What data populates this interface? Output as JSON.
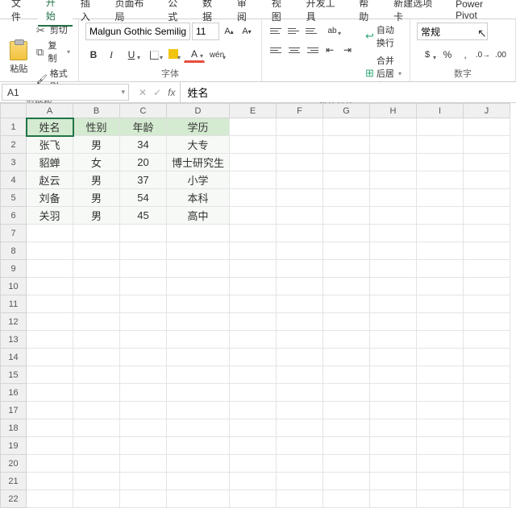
{
  "menus": [
    "文件",
    "开始",
    "插入",
    "页面布局",
    "公式",
    "数据",
    "审阅",
    "视图",
    "开发工具",
    "帮助",
    "新建选项卡",
    "Power Pivot"
  ],
  "active_menu": 1,
  "clipboard": {
    "paste": "粘贴",
    "cut": "剪切",
    "copy": "复制",
    "format": "格式刷",
    "label": "剪贴板"
  },
  "font": {
    "name": "Malgun Gothic Semilight",
    "size": "11",
    "label": "字体"
  },
  "align": {
    "wrap": "自动换行",
    "merge": "合并后居中",
    "label": "对齐方式"
  },
  "number": {
    "format": "常规",
    "label": "数字"
  },
  "namebox": "A1",
  "formula": "姓名",
  "columns": [
    "A",
    "B",
    "C",
    "D",
    "E",
    "F",
    "G",
    "H",
    "I",
    "J"
  ],
  "row_count": 22,
  "headers": [
    "姓名",
    "性别",
    "年龄",
    "学历"
  ],
  "data_rows": [
    [
      "张飞",
      "男",
      "34",
      "大专"
    ],
    [
      "貂蝉",
      "女",
      "20",
      "博士研究生"
    ],
    [
      "赵云",
      "男",
      "37",
      "小学"
    ],
    [
      "刘备",
      "男",
      "54",
      "本科"
    ],
    [
      "关羽",
      "男",
      "45",
      "高中"
    ]
  ],
  "chart_data": {
    "type": "table",
    "columns": [
      "姓名",
      "性别",
      "年龄",
      "学历"
    ],
    "rows": [
      {
        "姓名": "张飞",
        "性别": "男",
        "年龄": 34,
        "学历": "大专"
      },
      {
        "姓名": "貂蝉",
        "性别": "女",
        "年龄": 20,
        "学历": "博士研究生"
      },
      {
        "姓名": "赵云",
        "性别": "男",
        "年龄": 37,
        "学历": "小学"
      },
      {
        "姓名": "刘备",
        "性别": "男",
        "年龄": 54,
        "学历": "本科"
      },
      {
        "姓名": "关羽",
        "性别": "男",
        "年龄": 45,
        "学历": "高中"
      }
    ]
  }
}
